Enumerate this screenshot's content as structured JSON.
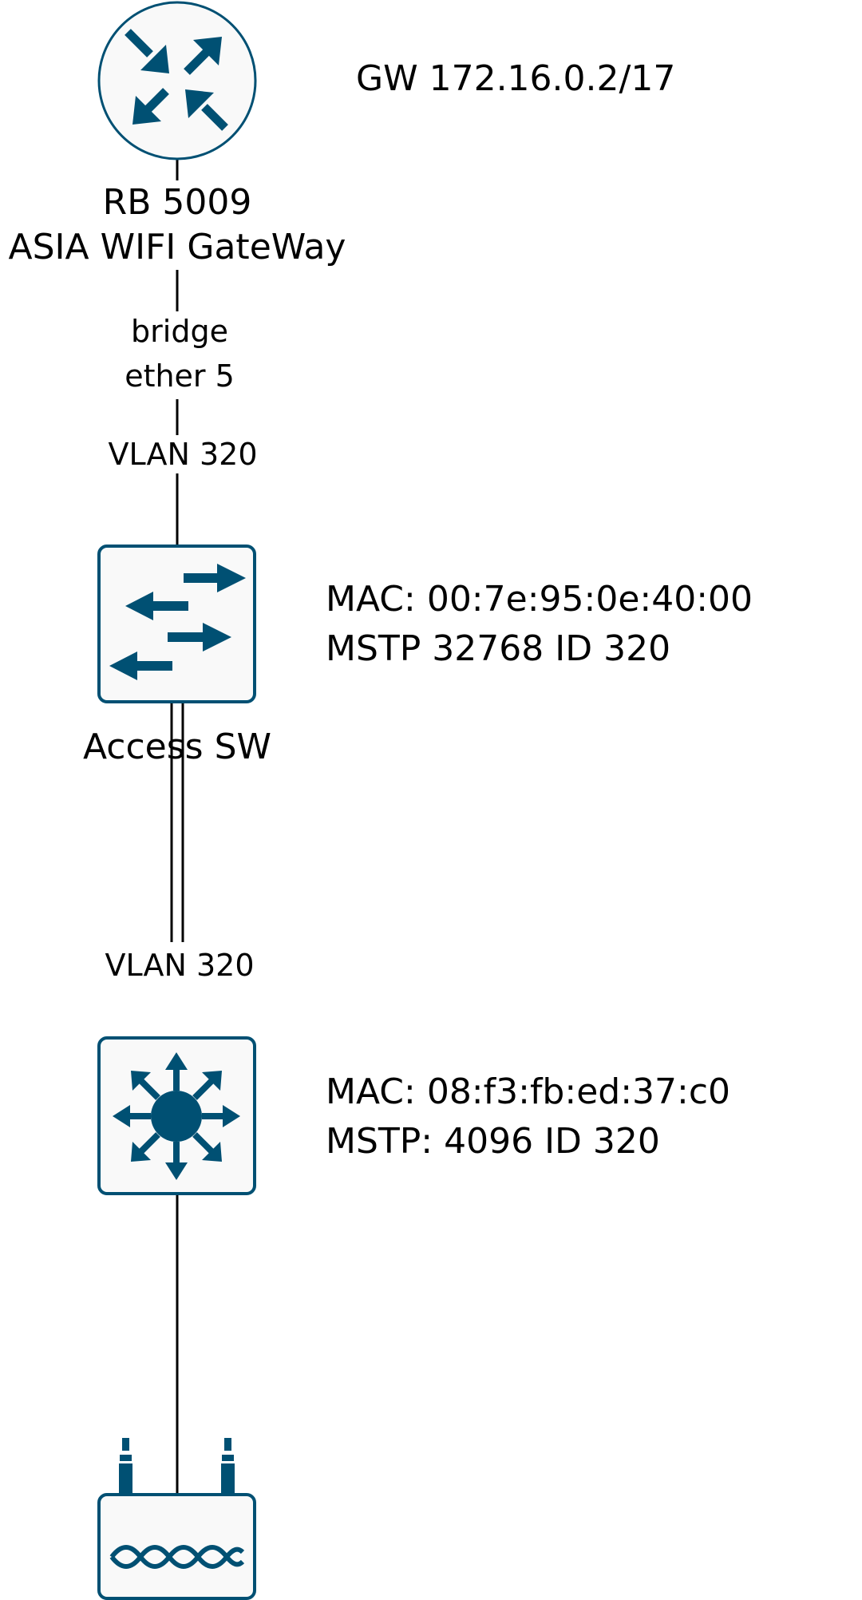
{
  "colors": {
    "icon": "#005073",
    "icon_bg": "#F9F9F9",
    "line": "#000000"
  },
  "nodes": {
    "router": {
      "icon": "router-icon",
      "line1": "RB 5009",
      "line2": "ASIA WIFI GateWay",
      "note": "GW 172.16.0.2/17"
    },
    "access_switch": {
      "icon": "switch-icon",
      "name": "Access SW",
      "mac": "MAC: 00:7e:95:0e:40:00",
      "mstp": "MSTP 32768 ID 320"
    },
    "core_switch": {
      "icon": "layer3-switch-icon",
      "mac": "MAC: 08:f3:fb:ed:37:c0",
      "mstp": "MSTP: 4096 ID 320"
    },
    "access_point": {
      "icon": "wireless-router-icon"
    }
  },
  "links": {
    "router_to_access": {
      "line1": "bridge",
      "line2": "ether 5",
      "vlan": "VLAN 320"
    },
    "access_to_core": {
      "vlan": "VLAN 320"
    }
  }
}
